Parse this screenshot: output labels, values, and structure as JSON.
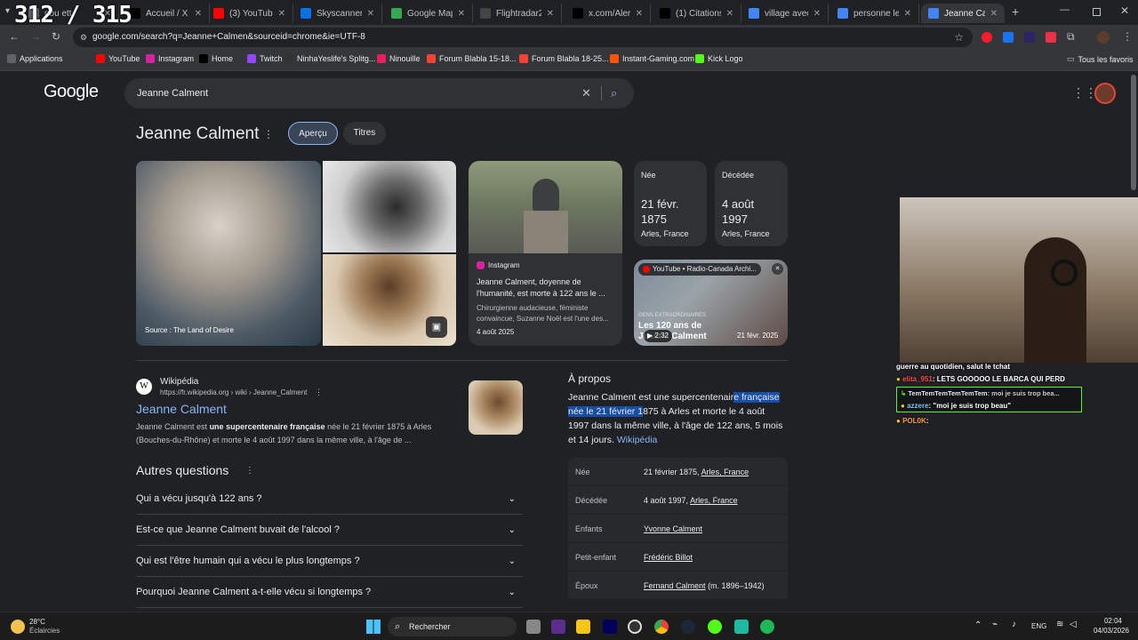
{
  "overlay_counter": "312 / 315",
  "tabs": [
    {
      "label": "pou ett",
      "icon": "document-icon",
      "color": "#5f6368"
    },
    {
      "label": "Accueil / X",
      "icon": "x-icon",
      "color": "#000000"
    },
    {
      "label": "(3) YouTube",
      "icon": "youtube-icon",
      "color": "#ff0000"
    },
    {
      "label": "Skyscanner | Tr",
      "icon": "skyscanner-icon",
      "color": "#0770e3"
    },
    {
      "label": "Google Maps",
      "icon": "maps-icon",
      "color": "#34a853"
    },
    {
      "label": "Flightradar24:",
      "icon": "flightradar-icon",
      "color": "#444444"
    },
    {
      "label": "x.com/Alertesh",
      "icon": "x-icon",
      "color": "#000000"
    },
    {
      "label": "(1) Citations de",
      "icon": "x-icon",
      "color": "#000000"
    },
    {
      "label": "village avec les",
      "icon": "google-icon",
      "color": "#4285f4"
    },
    {
      "label": "personne le plu",
      "icon": "google-icon",
      "color": "#4285f4"
    },
    {
      "label": "Jeanne Calme",
      "icon": "google-icon",
      "color": "#4285f4"
    }
  ],
  "url": "google.com/search?q=Jeanne+Calmen&sourceid=chrome&ie=UTF-8",
  "bookmarks": [
    {
      "label": "Applications",
      "icon": "apps-icon",
      "color": "#5f6368"
    },
    {
      "label": "YouTube",
      "icon": "youtube-icon",
      "color": "#ff0000"
    },
    {
      "label": "Instagram",
      "icon": "instagram-icon",
      "color": "#d6249f"
    },
    {
      "label": "Home",
      "icon": "x-icon",
      "color": "#000000"
    },
    {
      "label": "Twitch",
      "icon": "twitch-icon",
      "color": "#9146ff"
    },
    {
      "label": "NinhaYeslife's Splitg...",
      "icon": "splitgate-icon",
      "color": "#333333"
    },
    {
      "label": "Ninouille",
      "icon": "ninouille-icon",
      "color": "#e91e63"
    },
    {
      "label": "Forum Blabla 15-18...",
      "icon": "jvc-icon",
      "color": "#f44336"
    },
    {
      "label": "Forum Blabla 18-25...",
      "icon": "jvc-icon",
      "color": "#f44336"
    },
    {
      "label": "Instant-Gaming.com",
      "icon": "instant-gaming-icon",
      "color": "#ff5400"
    },
    {
      "label": "Kick Logo",
      "icon": "kick-icon",
      "color": "#53fc18"
    }
  ],
  "all_bookmarks": "Tous les favoris",
  "google": {
    "logo": "Google",
    "query": "Jeanne Calment",
    "entity_title": "Jeanne Calment",
    "pill_overview": "Aperçu",
    "pill_titles": "Titres",
    "image_source": "Source : The Land of Desire"
  },
  "instagram_card": {
    "source": "Instagram",
    "title": "Jeanne Calment, doyenne de l'humanité, est morte à 122 ans le ...",
    "snippet": "Chirurgienne audacieuse, féministe convaincue, Suzanne Noël est l'une des...",
    "date": "4 août 2025"
  },
  "born_card": {
    "label": "Née",
    "date": "21 févr. 1875",
    "place": "Arles, France"
  },
  "died_card": {
    "label": "Décédée",
    "date": "4 août 1997",
    "place": "Arles, France"
  },
  "video_card": {
    "source": "YouTube • Radio-Canada Archi...",
    "kicker": "GENS EXTRAORDINAIRES",
    "overlay_title_1": "Les 120 ans de",
    "overlay_title_2": "Jeanne Calment",
    "duration": "2:32",
    "date": "21 févr. 2025"
  },
  "wiki_result": {
    "site": "Wikipédia",
    "url": "https://fr.wikipedia.org › wiki › Jeanne_Calment",
    "title": "Jeanne Calment",
    "snippet_1": "Jeanne Calment est",
    "snippet_bold": "une supercentenaire française",
    "snippet_2": "née le 21 février 1875 à Arles (Bouches-du-Rhône) et morte le 4 août 1997 dans la même ville, à l'âge de ..."
  },
  "questions": {
    "heading": "Autres questions",
    "items": [
      "Qui a vécu jusqu'à 122 ans ?",
      "Est-ce que Jeanne Calment buvait de l'alcool ?",
      "Qui est l'être humain qui a vécu le plus longtemps ?",
      "Pourquoi Jeanne Calment a-t-elle vécu si longtemps ?"
    ]
  },
  "about": {
    "heading": "À propos",
    "text_1": "Jeanne Calment est une supercentenair",
    "text_highlight_1": "e française",
    "text_highlight_2": "née le 21 février 1",
    "text_2": "875 à Arles et morte le 4 août 1997 dans la même ville, à l'âge de 122 ans, 5 mois et 14 jours.",
    "source_link": "Wikipédia"
  },
  "facts": [
    {
      "key": "Née",
      "value": "21 février 1875,",
      "link": "Arles, France"
    },
    {
      "key": "Décédée",
      "value": "4 août 1997,",
      "link": "Arles, France"
    },
    {
      "key": "Enfants",
      "value": "",
      "link": "Yvonne Calment"
    },
    {
      "key": "Petit-enfant",
      "value": "",
      "link": "Frédéric Billot"
    },
    {
      "key": "Époux",
      "value": "(m. 1896–1942)",
      "link": "Fernand Calment"
    }
  ],
  "chat": {
    "line_0": "guerre au quotidien, salut le tchat",
    "line_1_user": "elita_951",
    "line_1_text": ": LETS GOOOOO LE BARCA QUI PERD",
    "reply_user": "TemTemTemTemTemTem",
    "reply_text": ": moi je suis trop bea...",
    "line_2_user": "azzere",
    "line_2_text": ": \"moi je suis trop beau\"",
    "line_3_user": "POL0K",
    "line_3_text": ":"
  },
  "taskbar": {
    "weather_temp": "28°C",
    "weather_desc": "Éclaircies",
    "search_label": "Rechercher",
    "lang": "ENG",
    "time": "02:04",
    "date": "04/03/2026"
  },
  "colors": {
    "highlight": "#174ea6",
    "link": "#8ab4f8",
    "card_bg": "#303134"
  }
}
